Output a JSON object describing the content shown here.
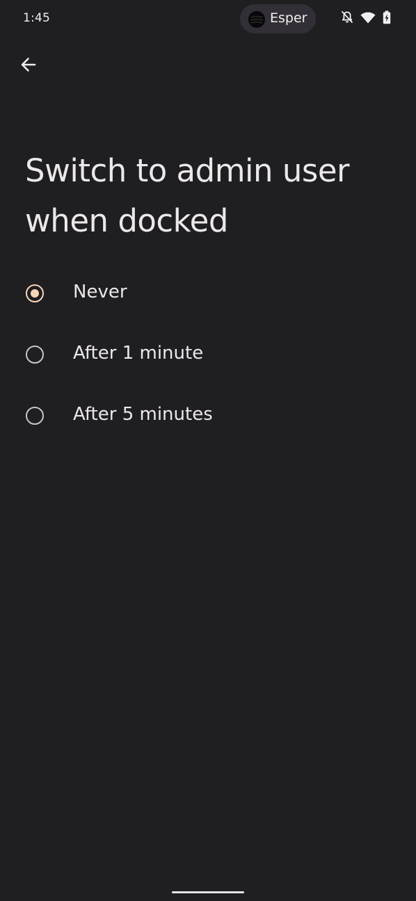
{
  "status_bar": {
    "time": "1:45",
    "app_pill": {
      "label": "Esper",
      "logo_icon": "esper-logo-icon"
    },
    "icons": [
      "notifications-off-icon",
      "wifi-icon",
      "battery-charging-icon"
    ]
  },
  "toolbar": {
    "back_icon": "arrow-back-icon"
  },
  "page": {
    "title": "Switch to admin user when docked",
    "options": [
      {
        "label": "Never",
        "selected": true
      },
      {
        "label": "After 1 minute",
        "selected": false
      },
      {
        "label": "After 5 minutes",
        "selected": false
      }
    ]
  },
  "colors": {
    "background": "#1f1e21",
    "accent": "#f7d6b8",
    "text": "#ece8ea",
    "radio_unselected": "#cac4cb"
  }
}
